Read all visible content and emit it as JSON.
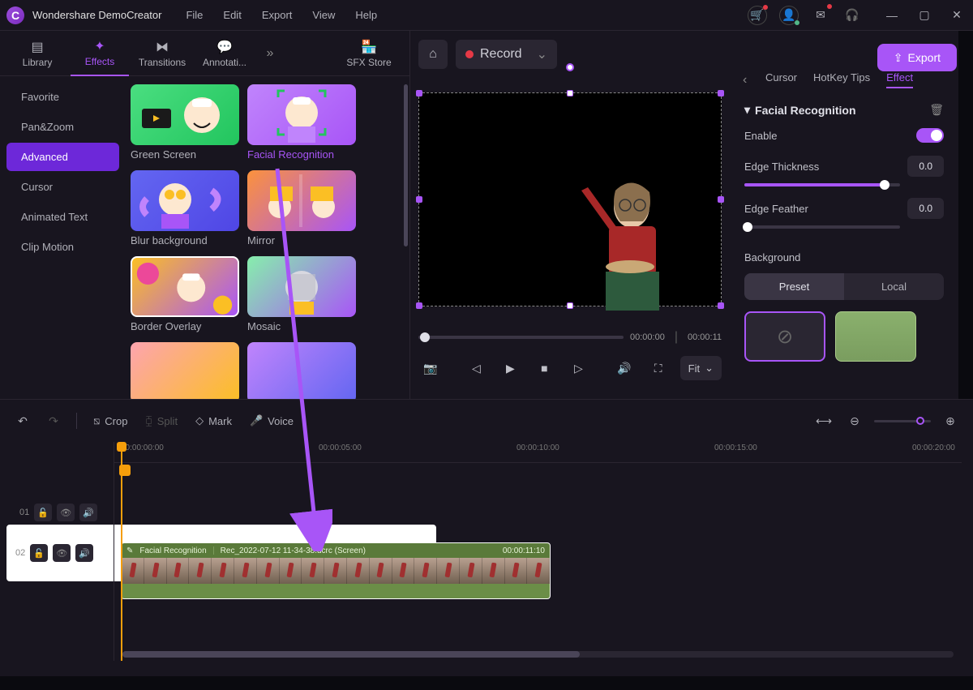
{
  "app": {
    "title": "Wondershare DemoCreator"
  },
  "menu": [
    "File",
    "Edit",
    "Export",
    "View",
    "Help"
  ],
  "tabs": {
    "library": "Library",
    "effects": "Effects",
    "transitions": "Transitions",
    "annotations": "Annotati...",
    "sfx": "SFX Store"
  },
  "sidebar": {
    "items": [
      "Favorite",
      "Pan&Zoom",
      "Advanced",
      "Cursor",
      "Animated Text",
      "Clip Motion"
    ],
    "active_index": 2
  },
  "effects": [
    {
      "name": "Green Screen",
      "selected": false
    },
    {
      "name": "Facial Recognition",
      "selected": true
    },
    {
      "name": "Blur background",
      "selected": false
    },
    {
      "name": "Mirror",
      "selected": false
    },
    {
      "name": "Border Overlay",
      "selected": false
    },
    {
      "name": "Mosaic",
      "selected": false
    }
  ],
  "preview": {
    "record_label": "Record",
    "current_time": "00:00:00",
    "duration": "00:00:11",
    "fit_label": "Fit"
  },
  "right_panel": {
    "tabs": [
      "Cursor",
      "HotKey Tips",
      "Effect"
    ],
    "active_tab": 2,
    "section_title": "Facial Recognition",
    "enable_label": "Enable",
    "enable": true,
    "edge_thickness": {
      "label": "Edge Thickness",
      "value": "0.0",
      "pct": 90
    },
    "edge_feather": {
      "label": "Edge Feather",
      "value": "0.0",
      "pct": 2
    },
    "background": {
      "label": "Background",
      "tabs": [
        "Preset",
        "Local"
      ],
      "active": 0
    }
  },
  "export_label": "Export",
  "timeline": {
    "toolbar": {
      "crop": "Crop",
      "split": "Split",
      "mark": "Mark",
      "voice": "Voice"
    },
    "ruler": [
      "00:00:00:00",
      "00:00:05:00",
      "00:00:10:00",
      "00:00:15:00",
      "00:00:20:00"
    ],
    "track_labels": {
      "t02": "02",
      "t01": "01"
    },
    "clip": {
      "effect": "Facial Recognition",
      "name": "Rec_2022-07-12 11-34-38.dcrc (Screen)",
      "duration": "00:00:11:10"
    }
  }
}
